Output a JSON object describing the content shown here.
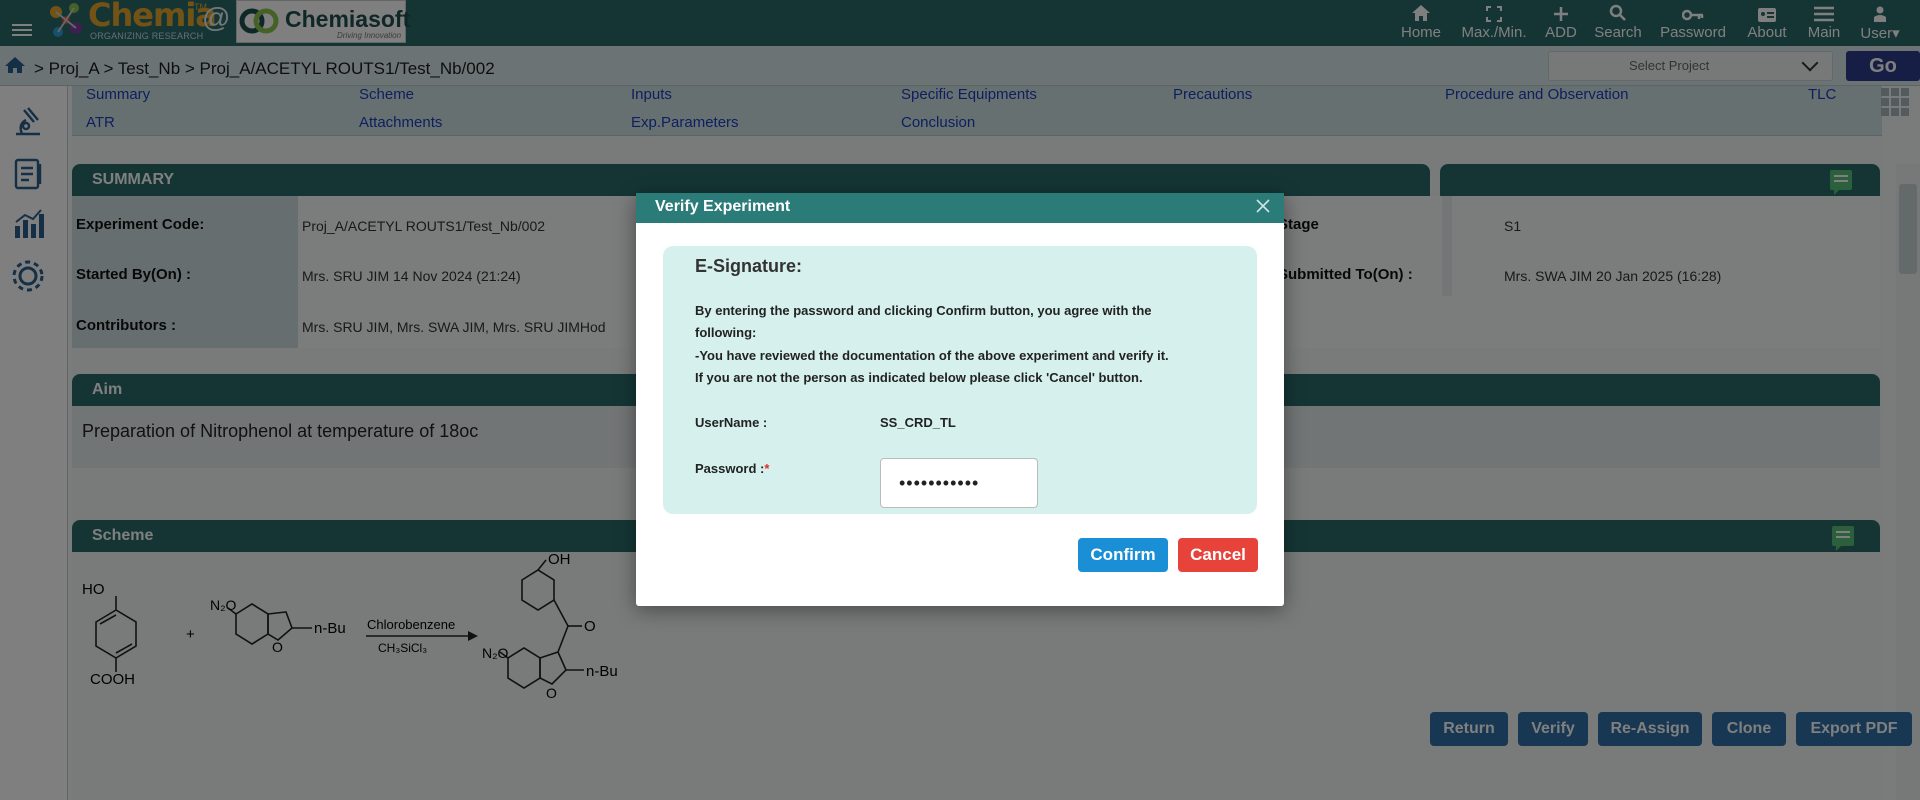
{
  "topbar": {
    "logo_brand": "Chemia",
    "logo_tm": "TM",
    "logo_tagline": "ORGANIZING RESEARCH",
    "logo_at": "@",
    "logo2_name": "Chemiasoft",
    "logo2_tagline": "Driving Innovation",
    "nav": [
      {
        "label": "Home",
        "icon": "home-icon"
      },
      {
        "label": "Max./Min.",
        "icon": "expand-icon"
      },
      {
        "label": "ADD",
        "icon": "plus-icon"
      },
      {
        "label": "Search",
        "icon": "search-icon"
      },
      {
        "label": "Password",
        "icon": "key-icon"
      },
      {
        "label": "About",
        "icon": "about-card-icon"
      },
      {
        "label": "Main",
        "icon": "menu-lines-icon"
      },
      {
        "label": "User",
        "icon": "user-icon"
      }
    ]
  },
  "breadcrumb": {
    "text": "> Proj_A > Test_Nb > Proj_A/ACETYL ROUTS1/Test_Nb/002"
  },
  "project_select": {
    "placeholder": "Select Project"
  },
  "go_label": "Go",
  "tabs": [
    "Summary",
    "Scheme",
    "Inputs",
    "Specific Equipments",
    "Precautions",
    "Procedure and Observation",
    "TLC",
    "ATR",
    "Attachments",
    "Exp.Parameters",
    "Conclusion"
  ],
  "summary": {
    "header": "SUMMARY",
    "experiment_code_label": "Experiment Code:",
    "experiment_code": "Proj_A/ACETYL ROUTS1/Test_Nb/002",
    "started_by_label": "Started By(On) :",
    "started_by": "Mrs. SRU JIM 14 Nov 2024 (21:24)",
    "contributors_label": "Contributors :",
    "contributors": "Mrs. SRU JIM, Mrs. SWA JIM, Mrs. SRU JIMHod",
    "stage_label": "Stage",
    "stage": "S1",
    "submitted_to_label": "Submitted To(On) :",
    "submitted_to": "Mrs. SWA JIM 20 Jan 2025 (16:28)"
  },
  "aim": {
    "header": "Aim",
    "text": "Preparation of Nitrophenol at temperature of 18oc"
  },
  "scheme": {
    "header": "Scheme",
    "r1_oh": "HO",
    "r1_cooh": "COOH",
    "plus": "+",
    "r2_no2": "N₂O",
    "r2_nbu": "n-Bu",
    "reagent_top": "Chlorobenzene",
    "reagent_bottom": "CH₃SiCl₃",
    "p_oh": "OH",
    "p_o": "O",
    "p_no2": "N₂O",
    "p_nbu": "n-Bu",
    "ring_o": "O"
  },
  "actions": [
    "Return",
    "Verify",
    "Re-Assign",
    "Clone",
    "Export PDF"
  ],
  "modal": {
    "title": "Verify Experiment",
    "esig_title": "E-Signature:",
    "line1": "By entering the password and clicking Confirm button, you agree with the",
    "line2": "following:",
    "line3": "-You have reviewed the documentation of the above experiment and verify it.",
    "line4": "If you are not the person as indicated below please click 'Cancel' button.",
    "username_label": "UserName :",
    "username": "SS_CRD_TL",
    "password_label": "Password :",
    "required_mark": "*",
    "password_mask": "•••••••••••",
    "confirm": "Confirm",
    "cancel": "Cancel"
  },
  "colors": {
    "primary": "#2b6b6a",
    "confirm": "#1a8fd6",
    "cancel": "#e8433a",
    "action": "#2f6fa7",
    "go": "#2e3d8a"
  }
}
